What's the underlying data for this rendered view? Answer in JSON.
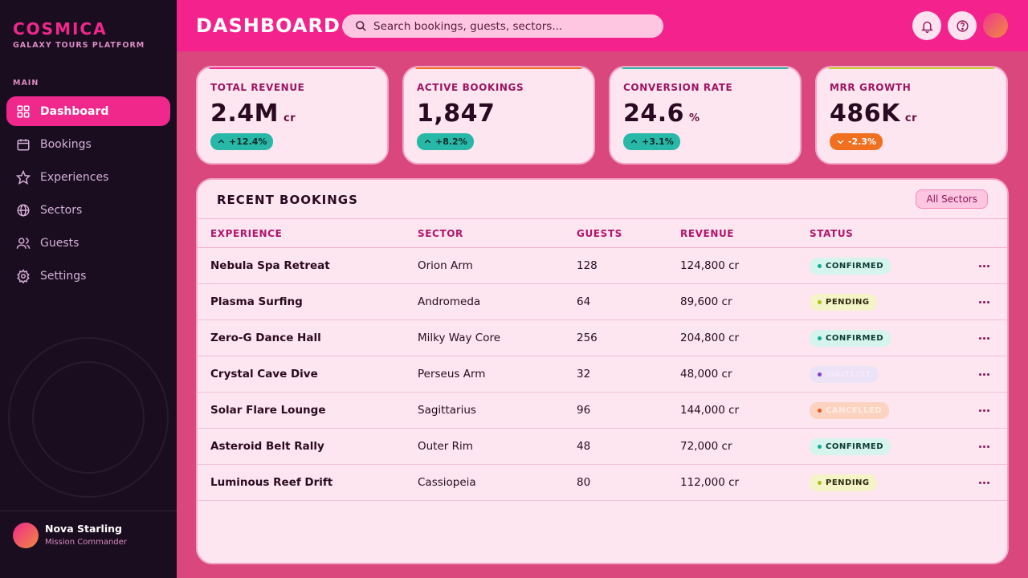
{
  "brand": {
    "name": "COSMICA",
    "tagline": "GALAXY TOURS PLATFORM"
  },
  "sidebar": {
    "section_label": "MAIN",
    "items": [
      {
        "label": "Dashboard",
        "icon": "grid-icon",
        "active": true
      },
      {
        "label": "Bookings",
        "icon": "calendar-icon",
        "active": false
      },
      {
        "label": "Experiences",
        "icon": "star-icon",
        "active": false
      },
      {
        "label": "Sectors",
        "icon": "globe-icon",
        "active": false
      },
      {
        "label": "Guests",
        "icon": "users-icon",
        "active": false
      },
      {
        "label": "Settings",
        "icon": "gear-icon",
        "active": false
      }
    ],
    "profile": {
      "name": "Nova Starling",
      "role": "Mission Commander"
    }
  },
  "header": {
    "title": "DASHBOARD",
    "search_placeholder": "Search bookings, guests, sectors..."
  },
  "stats": [
    {
      "label": "TOTAL REVENUE",
      "value": "2.4M",
      "unit": "cr",
      "change": "+12.4%",
      "direction": "up",
      "accent": "#f0288c"
    },
    {
      "label": "ACTIVE BOOKINGS",
      "value": "1,847",
      "unit": "",
      "change": "+8.2%",
      "direction": "up",
      "accent": "#f07020"
    },
    {
      "label": "CONVERSION RATE",
      "value": "24.6",
      "unit": "%",
      "change": "+3.1%",
      "direction": "up",
      "accent": "#28b8a8"
    },
    {
      "label": "MRR GROWTH",
      "value": "486K",
      "unit": "cr",
      "change": "-2.3%",
      "direction": "down",
      "accent": "#c8d030"
    }
  ],
  "bookings": {
    "title": "RECENT BOOKINGS",
    "filter_label": "All Sectors",
    "columns": [
      "EXPERIENCE",
      "SECTOR",
      "GUESTS",
      "REVENUE",
      "STATUS"
    ],
    "rows": [
      {
        "experience": "Nebula Spa Retreat",
        "sector": "Orion Arm",
        "guests": "128",
        "revenue": "124,800 cr",
        "status": "CONFIRMED"
      },
      {
        "experience": "Plasma Surfing",
        "sector": "Andromeda",
        "guests": "64",
        "revenue": "89,600 cr",
        "status": "PENDING"
      },
      {
        "experience": "Zero-G Dance Hall",
        "sector": "Milky Way Core",
        "guests": "256",
        "revenue": "204,800 cr",
        "status": "CONFIRMED"
      },
      {
        "experience": "Crystal Cave Dive",
        "sector": "Perseus Arm",
        "guests": "32",
        "revenue": "48,000 cr",
        "status": "WAITLIST"
      },
      {
        "experience": "Solar Flare Lounge",
        "sector": "Sagittarius",
        "guests": "96",
        "revenue": "144,000 cr",
        "status": "CANCELLED"
      },
      {
        "experience": "Asteroid Belt Rally",
        "sector": "Outer Rim",
        "guests": "48",
        "revenue": "72,000 cr",
        "status": "CONFIRMED"
      },
      {
        "experience": "Luminous Reef Drift",
        "sector": "Cassiopeia",
        "guests": "80",
        "revenue": "112,000 cr",
        "status": "PENDING"
      }
    ]
  }
}
